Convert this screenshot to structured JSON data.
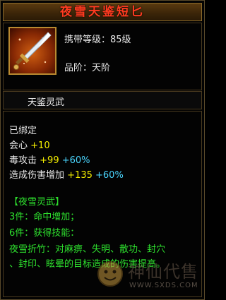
{
  "item": {
    "title": "夜雪天鉴短匕",
    "level_label": "携带等级：85级",
    "rank_label": "品阶：天阶",
    "set_name": "天鉴灵武"
  },
  "stats": {
    "bound": "已绑定",
    "crit": {
      "label": "会心",
      "value": "+10"
    },
    "poison": {
      "label": "毒攻击",
      "value": "+99",
      "bonus": "+60%"
    },
    "damage": {
      "label": "造成伤害增加",
      "value": "+135",
      "bonus": "+60%"
    }
  },
  "set_bonus": {
    "name": "【夜雪灵武】",
    "piece3": "3件：命中增加；",
    "piece6": "6件：获得技能：",
    "skill_line1": "夜雪折竹：对麻痹、失明、散功、封穴",
    "skill_line2": "、封印、眩晕的目标造成的伤害提高。"
  },
  "watermark": {
    "text": "神仙代售",
    "url": "WWW.SXDS.COM"
  },
  "colors": {
    "title": "#ff3b20",
    "stat_value": "#f6f000",
    "bonus": "#4ad6ff",
    "set_text": "#2ee02e",
    "border": "#b98a30"
  },
  "icon": "dagger-icon"
}
